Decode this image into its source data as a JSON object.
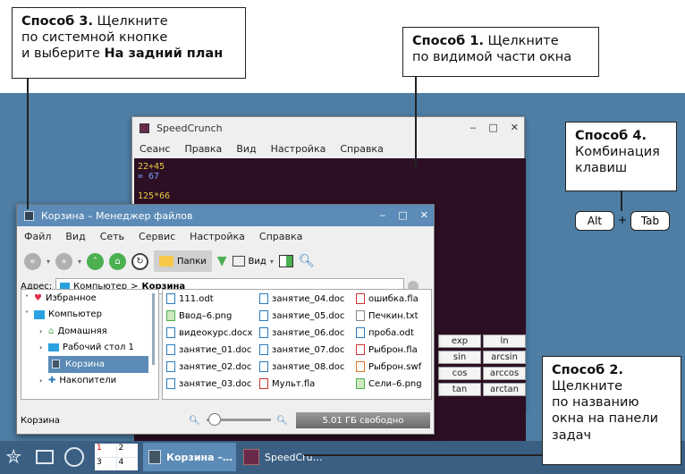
{
  "callouts": {
    "method3": {
      "bold": "Способ 3.",
      "rest1": " Щелкните",
      "line2": "по системной кнопке",
      "line3a": "и выберите ",
      "line3b": "На задний план"
    },
    "method1": {
      "bold": "Способ 1.",
      "rest1": " Щелкните",
      "line2": "по видимой части окна"
    },
    "method4": {
      "bold": "Способ 4.",
      "line2": "Комбинация",
      "line3": "клавиш"
    },
    "method2": {
      "bold": "Способ 2.",
      "line2": "Щелкните",
      "line3": "по названию",
      "line4": "окна на панели",
      "line5": "задач"
    }
  },
  "keys": {
    "alt": "Alt",
    "plus": "+",
    "tab": "Tab"
  },
  "speedcrunch": {
    "title": "SpeedCrunch",
    "menu": [
      "Сеанс",
      "Правка",
      "Вид",
      "Настройка",
      "Справка"
    ],
    "history": [
      {
        "expr": "22+45",
        "result": "= 67"
      },
      {
        "expr": "125*66",
        "result": ""
      }
    ],
    "keypad": [
      "exp",
      "ln",
      "sin",
      "arcsin",
      "cos",
      "arccos",
      "tan",
      "arctan"
    ],
    "colors": {
      "background": "#2c0f24",
      "expr": "#e8c840",
      "result": "#7aa0ff"
    }
  },
  "filemanager": {
    "title": "Корзина – Менеджер файлов",
    "menu": [
      "Файл",
      "Вид",
      "Сеть",
      "Сервис",
      "Настройка",
      "Справка"
    ],
    "toolbar": {
      "places": "Папки",
      "view": "Вид"
    },
    "address": {
      "label": "Адрес:",
      "computer": "Компьютер",
      "sep": ">",
      "current": "Корзина"
    },
    "tree": [
      "Избранное",
      "Компьютер",
      "Домашняя",
      "Рабочий стол 1",
      "Корзина",
      "Накопители"
    ],
    "files": [
      [
        "111.odt",
        "занятие_04.doc",
        "ошибка.fla"
      ],
      [
        "Ввод–6.png",
        "занятие_05.doc",
        "Печкин.txt"
      ],
      [
        "видеокурс.docx",
        "занятие_06.doc",
        "проба.odt"
      ],
      [
        "занятие_01.doc",
        "занятие_07.doc",
        "Рыброн.fla"
      ],
      [
        "занятие_02.doc",
        "занятие_08.doc",
        "Рыброн.swf"
      ],
      [
        "занятие_03.doc",
        "Мульт.fla",
        "Сели–6.png"
      ]
    ],
    "status": {
      "location": "Корзина",
      "free": "5.01 ГБ свободно"
    }
  },
  "taskbar": {
    "pager": [
      "1",
      "2",
      "3",
      "4"
    ],
    "task1": "Корзина –…",
    "task2": "SpeedCru…",
    "colors": {
      "bar": "#3b5f83",
      "active": "#5b8bb6"
    }
  }
}
